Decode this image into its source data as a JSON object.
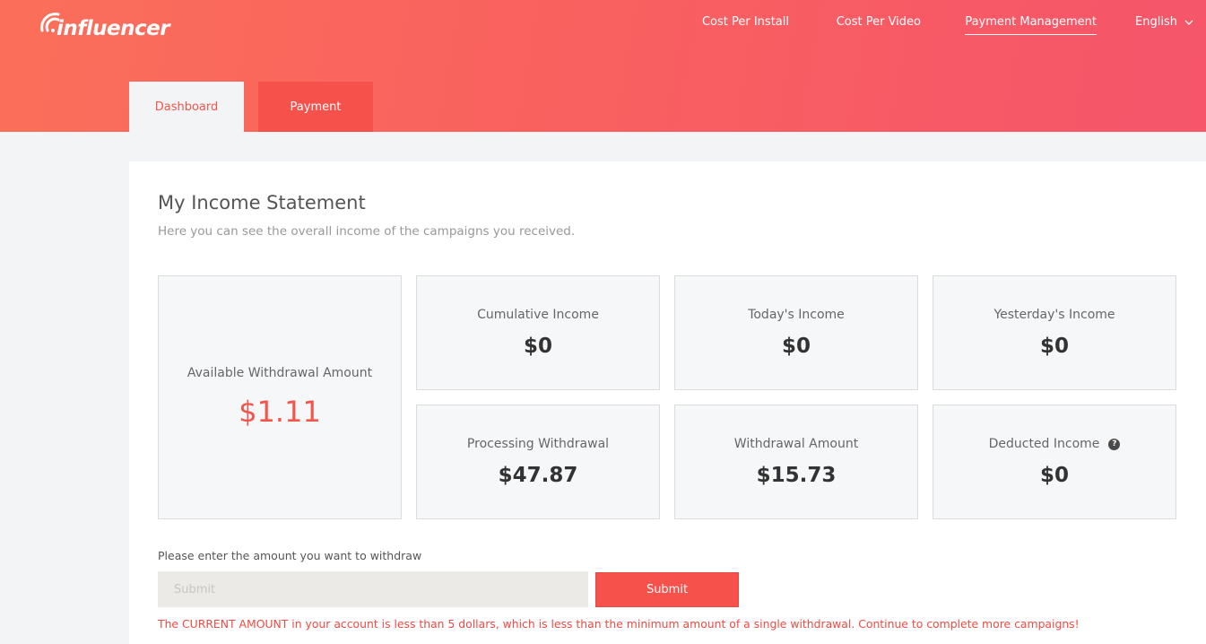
{
  "header": {
    "logo_text": "influencer",
    "nav": [
      {
        "label": "Cost Per Install"
      },
      {
        "label": "Cost Per Video"
      },
      {
        "label": "Payment Management"
      }
    ],
    "language": "English"
  },
  "tabs": [
    {
      "label": "Dashboard"
    },
    {
      "label": "Payment"
    }
  ],
  "statement": {
    "title": "My Income Statement",
    "subtitle": "Here you can see the overall income of the campaigns you received."
  },
  "cards": {
    "available": {
      "label": "Available Withdrawal Amount",
      "value": "$1.11"
    },
    "cumulative": {
      "label": "Cumulative Income",
      "value": "$0"
    },
    "today": {
      "label": "Today's Income",
      "value": "$0"
    },
    "yesterday": {
      "label": "Yesterday's Income",
      "value": "$0"
    },
    "processing": {
      "label": "Processing Withdrawal",
      "value": "$47.87"
    },
    "withdrawal": {
      "label": "Withdrawal Amount",
      "value": "$15.73"
    },
    "deducted": {
      "label": "Deducted Income",
      "value": "$0"
    }
  },
  "withdraw": {
    "label": "Please enter the amount you want to withdraw",
    "placeholder": "Submit",
    "submit_label": "Submit",
    "warning": "The CURRENT AMOUNT in your account is less than 5 dollars, which is less than the minimum amount of a single withdrawal. Continue to complete more campaigns!"
  },
  "colors": {
    "brand": "#f6514a",
    "header_gradient_start": "#fb6f5a",
    "header_gradient_end": "#f6556a",
    "highlight_value": "#f2554b"
  }
}
